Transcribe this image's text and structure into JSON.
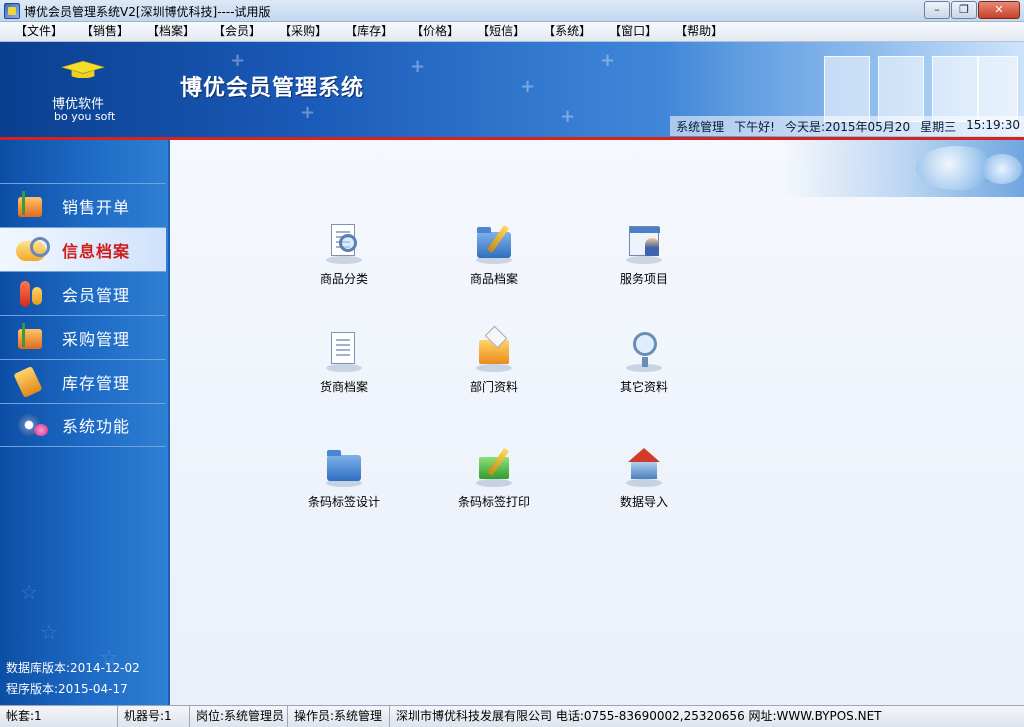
{
  "window": {
    "title": "博优会员管理系统V2[深圳博优科技]----试用版",
    "controls": {
      "minimize": "–",
      "maximize": "❐",
      "close": "✕"
    }
  },
  "menu": [
    "【文件】",
    "【销售】",
    "【档案】",
    "【会员】",
    "【采购】",
    "【库存】",
    "【价格】",
    "【短信】",
    "【系统】",
    "【窗口】",
    "【帮助】"
  ],
  "banner": {
    "logo_cn": "博优软件",
    "logo_en": "bo you soft",
    "app_title": "博优会员管理系统",
    "user": "系统管理",
    "greeting": "下午好!",
    "date": "今天是:2015年05月20",
    "weekday": "星期三",
    "time": "15:19:30"
  },
  "sidebar": {
    "items": [
      {
        "label": "销售开单",
        "icon": "sales-order-icon",
        "active": false
      },
      {
        "label": "信息档案",
        "icon": "info-archive-icon",
        "active": true
      },
      {
        "label": "会员管理",
        "icon": "member-icon",
        "active": false
      },
      {
        "label": "采购管理",
        "icon": "purchase-icon",
        "active": false
      },
      {
        "label": "库存管理",
        "icon": "inventory-icon",
        "active": false
      },
      {
        "label": "系统功能",
        "icon": "system-icon",
        "active": false
      }
    ],
    "db_version": "数据库版本:2014-12-02",
    "app_version": "程序版本:2015-04-17"
  },
  "tiles": [
    {
      "label": "商品分类",
      "icon": "magnifier-document-icon"
    },
    {
      "label": "商品档案",
      "icon": "folder-edit-icon"
    },
    {
      "label": "服务项目",
      "icon": "service-person-icon"
    },
    {
      "label": "货商档案",
      "icon": "supplier-document-icon"
    },
    {
      "label": "部门资料",
      "icon": "department-box-icon"
    },
    {
      "label": "其它资料",
      "icon": "other-search-icon"
    },
    {
      "label": "条码标签设计",
      "icon": "barcode-folder-icon"
    },
    {
      "label": "条码标签打印",
      "icon": "barcode-print-icon"
    },
    {
      "label": "数据导入",
      "icon": "data-import-house-icon"
    }
  ],
  "status": {
    "account": "帐套:1",
    "machine": "机器号:1",
    "post": "岗位:系统管理员",
    "operator": "操作员:系统管理",
    "company": "深圳市博优科技发展有限公司 电话:0755-83690002,25320656 网址:WWW.BYPOS.NET"
  },
  "colors": {
    "banner_dark": "#0a3f8f",
    "sidebar_blue": "#1f6cc6",
    "active_text": "#d11c1c",
    "accent_red": "#d6231c"
  }
}
